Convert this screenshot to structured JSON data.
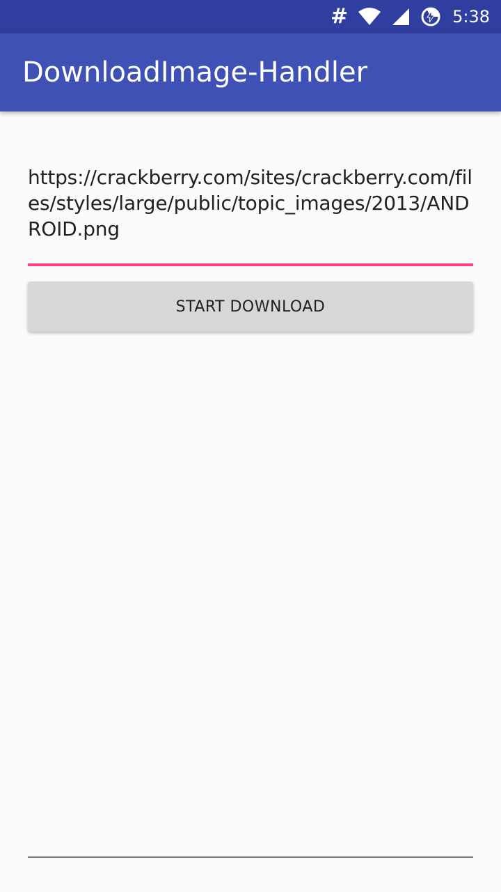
{
  "status_bar": {
    "notification_glyph": "#",
    "time": "5:38",
    "icons": [
      "hash-icon",
      "wifi-icon",
      "signal-icon",
      "battery-charging-icon"
    ]
  },
  "app_bar": {
    "title": "DownloadImage-Handler"
  },
  "url_input": {
    "value": "https://crackberry.com/sites/crackberry.com/files/styles/large/public/topic_images/2013/ANDROID.png"
  },
  "download_button": {
    "label": "START DOWNLOAD"
  },
  "colors": {
    "primary_dark": "#303F9F",
    "primary": "#3F51B5",
    "accent": "#FF4081",
    "background": "#fafafa",
    "button": "#d6d7d7"
  }
}
